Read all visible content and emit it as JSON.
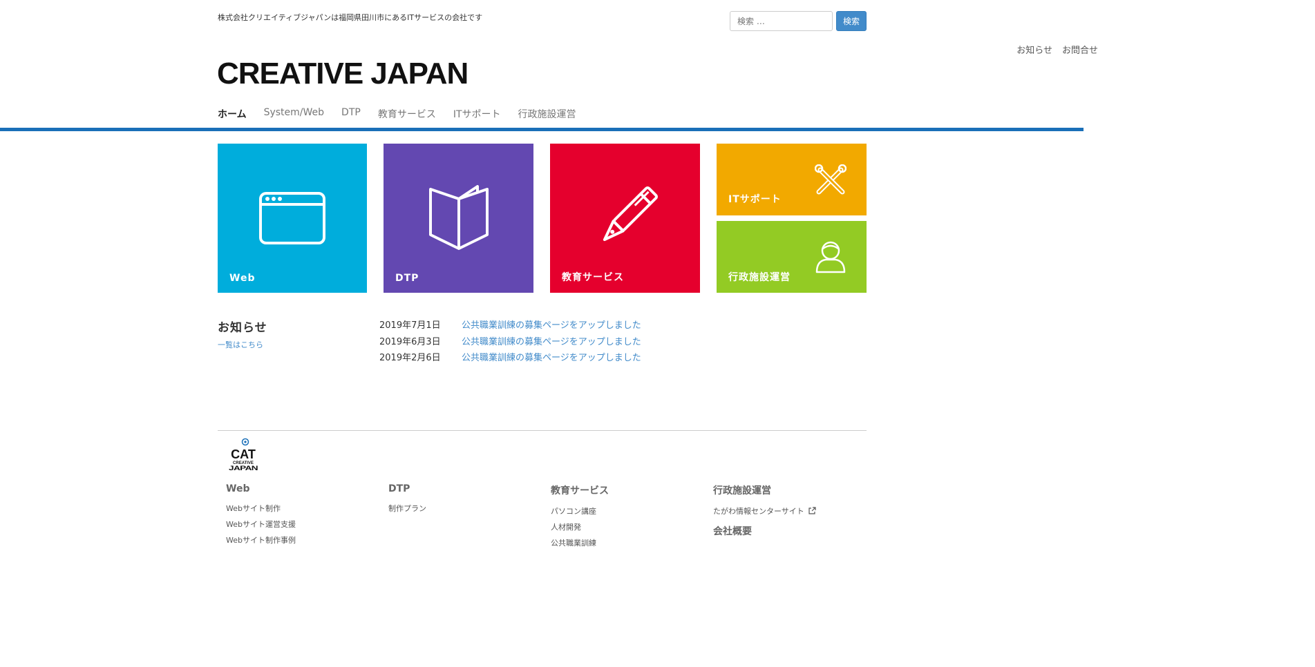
{
  "header": {
    "tagline": "株式会社クリエイティブジャパンは福岡県田川市にあるITサービスの会社です",
    "search_placeholder": "検索 …",
    "search_button": "検索",
    "top_links": [
      "お知らせ",
      "お問合せ"
    ],
    "logo": "CREATIVE JAPAN"
  },
  "nav": {
    "items": [
      "ホーム",
      "System/Web",
      "DTP",
      "教育サービス",
      "ITサポート",
      "行政施設運営"
    ],
    "active_index": 0
  },
  "tiles": {
    "web": {
      "label": "Web",
      "color": "#00addc",
      "icon": "browser-window-icon"
    },
    "dtp": {
      "label": "DTP",
      "color": "#6348b1",
      "icon": "open-book-icon"
    },
    "edu": {
      "label": "教育サービス",
      "color": "#e5002d",
      "icon": "pen-icon"
    },
    "it": {
      "label": "ITサポート",
      "color": "#f2a900",
      "icon": "tools-icon"
    },
    "gov": {
      "label": "行政施設運営",
      "color": "#93cb24",
      "icon": "person-icon"
    }
  },
  "news": {
    "title": "お知らせ",
    "all_link": "一覧はこちら",
    "items": [
      {
        "date": "2019年7月1日",
        "text": "公共職業訓練の募集ページをアップしました"
      },
      {
        "date": "2019年6月3日",
        "text": "公共職業訓練の募集ページをアップしました"
      },
      {
        "date": "2019年2月6日",
        "text": "公共職業訓練の募集ページをアップしました"
      }
    ]
  },
  "footer": {
    "logo_text": "CREATIVE JAPAN",
    "columns": [
      {
        "title": "Web",
        "links": [
          "Webサイト制作",
          "Webサイト運営支援",
          "Webサイト制作事例"
        ]
      },
      {
        "title": "DTP",
        "links": [
          "制作プラン"
        ]
      },
      {
        "title": "教育サービス",
        "links": [
          "パソコン講座",
          "人材開発",
          "公共職業訓練"
        ]
      },
      {
        "title": "行政施設運営",
        "links": [
          "たがわ情報センターサイト"
        ],
        "second_title": "会社概要"
      }
    ]
  },
  "colors": {
    "accent_bar": "#1a6fb8",
    "link": "#428bca"
  }
}
